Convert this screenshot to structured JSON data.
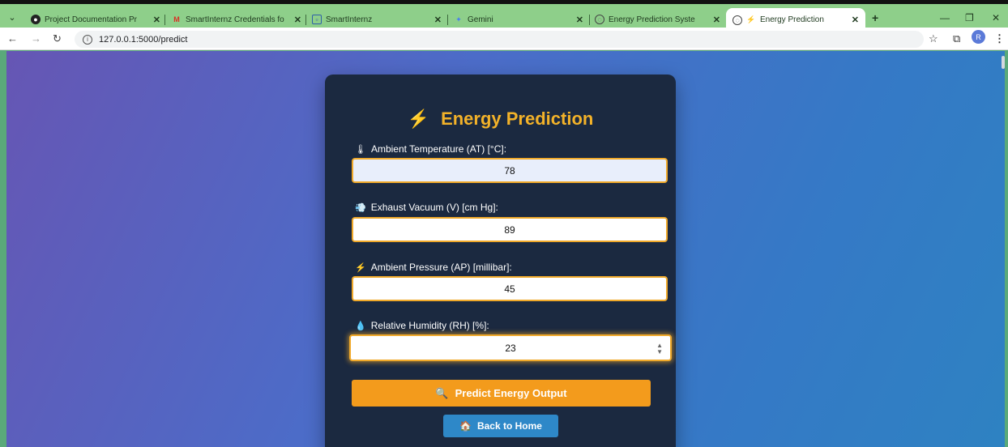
{
  "browser": {
    "tabs": [
      {
        "title": "Project Documentation Pr",
        "favicon": "circle-dark-icon"
      },
      {
        "title": "SmartInternz Credentials fo",
        "favicon": "gmail-icon"
      },
      {
        "title": "SmartInternz",
        "favicon": "smartinternz-icon"
      },
      {
        "title": "Gemini",
        "favicon": "gemini-icon"
      },
      {
        "title": "Energy Prediction Syste",
        "favicon": "globe-icon"
      },
      {
        "title": "Energy Prediction",
        "favicon": "globe-icon",
        "active": true
      }
    ],
    "url": "127.0.0.1:5000/predict",
    "profile_initial": "R"
  },
  "form": {
    "title": "Energy Prediction",
    "title_icon": "⚡",
    "fields": [
      {
        "icon": "🌡",
        "label": "Ambient Temperature (AT) [°C]:",
        "value": "78"
      },
      {
        "icon": "💨",
        "label": "Exhaust Vacuum (V) [cm Hg]:",
        "value": "89"
      },
      {
        "icon": "⚡",
        "label": "Ambient Pressure (AP) [millibar]:",
        "value": "45"
      },
      {
        "icon": "💧",
        "label": "Relative Humidity (RH) [%]:",
        "value": "23"
      }
    ],
    "predict_label": "Predict Energy Output",
    "predict_icon": "🔍",
    "home_label": "Back to Home",
    "home_icon": "🏠"
  },
  "colors": {
    "accent": "#f39b1c",
    "title": "#f3b229",
    "card": "#1b2940",
    "home_button": "#2e88c8"
  }
}
